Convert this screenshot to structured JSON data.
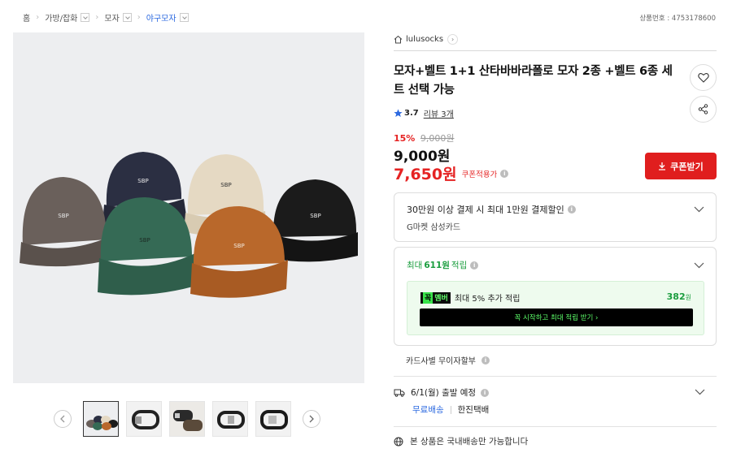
{
  "breadcrumb": {
    "home": "홈",
    "items": [
      "가방/잡화",
      "모자",
      "야구모자"
    ]
  },
  "product_id": "상품번호 : 4753178600",
  "shop": {
    "name": "lulusocks",
    "arrow": "›"
  },
  "product": {
    "title": "모자+벨트 1+1 산타바바라폴로 모자 2종 +벨트 6종 세트 선택 가능",
    "rating": "3.7",
    "reviews": "리뷰 3개",
    "discount_pct": "15%",
    "original_price": "9,000원",
    "price": "9,000원",
    "coupon_price": "7,650원",
    "coupon_label": "쿠폰적용가",
    "coupon_button": "쿠폰받기"
  },
  "benefit": {
    "card_title": "30만원 이상 결제 시 최대 1만원 결제할인",
    "card_sub": "G마켓 삼성카드",
    "points_prefix": "최대",
    "points_value": "611원",
    "points_suffix": "적립",
    "member_badge_k": "꼭",
    "member_badge": "멤버",
    "member_text": "최대 5% 추가 적립",
    "member_points": "382",
    "member_points_unit": "원",
    "member_cta": "꼭 시작하고 최대 적립 받기  ›",
    "installment": "카드사별 무이자할부"
  },
  "shipping": {
    "date": "6/1(월) 출발 예정",
    "free": "무료배송",
    "carrier": "한진택배",
    "domestic": "본 상품은 국내배송만 가능합니다"
  },
  "icons": {
    "star_color": "#2d6ae0",
    "accent_red": "#e01e1e",
    "accent_green": "#1a9d3e"
  }
}
